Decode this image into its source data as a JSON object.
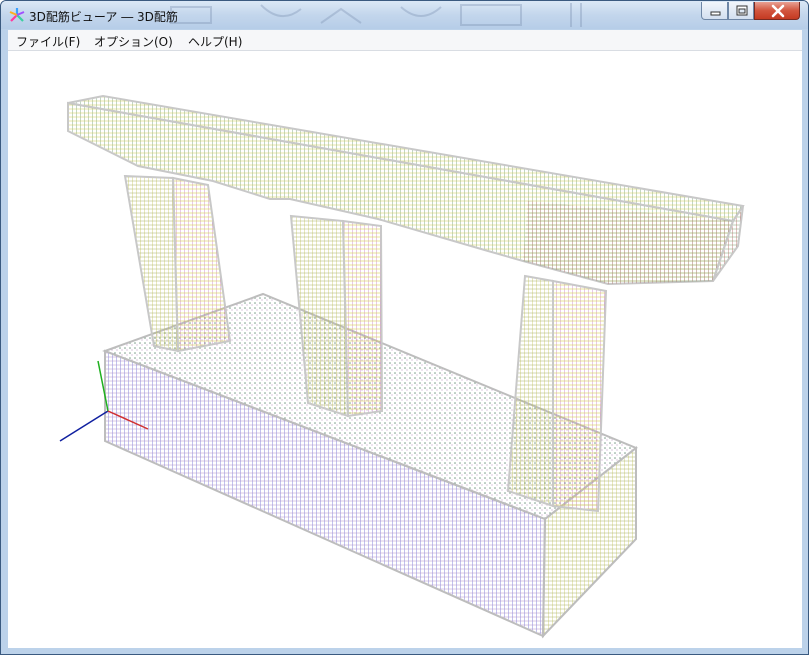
{
  "window": {
    "title": "3D配筋ビューア ― 3D配筋",
    "controls": [
      "minimize",
      "maximize",
      "close"
    ]
  },
  "menubar": {
    "items": [
      {
        "label": "ファイル(F)"
      },
      {
        "label": "オプション(O)"
      },
      {
        "label": "ヘルプ(H)"
      }
    ]
  },
  "viewport": {
    "content": "3d-rebar-model",
    "axes_colors": {
      "x": "#d03030",
      "y": "#20b020",
      "z": "#1020a0"
    },
    "rebar_colors": [
      "#7aa070",
      "#c8c840",
      "#d050c0",
      "#8080e0",
      "#c06060"
    ]
  },
  "icons": {
    "app": "rebar-app-icon",
    "minimize": "minimize-icon",
    "maximize": "maximize-icon",
    "close": "close-icon"
  }
}
